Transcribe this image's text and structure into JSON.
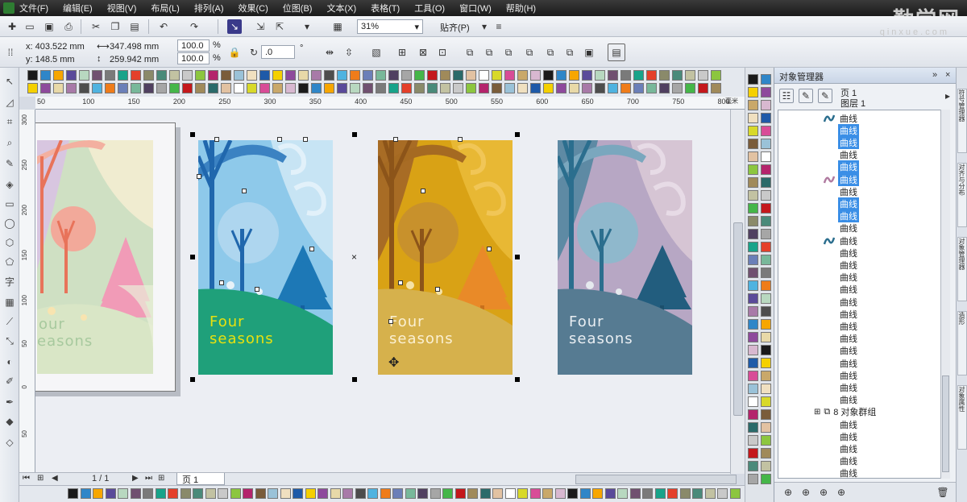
{
  "menu": [
    "文件(F)",
    "编辑(E)",
    "视图(V)",
    "布局(L)",
    "排列(A)",
    "效果(C)",
    "位图(B)",
    "文本(X)",
    "表格(T)",
    "工具(O)",
    "窗口(W)",
    "帮助(H)"
  ],
  "watermark": {
    "main": "勤学网",
    "sub": "qinxue.com"
  },
  "toolbar": {
    "zoom": "31%",
    "snap_label": "贴齐(P)"
  },
  "property_bar": {
    "x": "x: 403.522 mm",
    "y": "y: 148.5 mm",
    "width": "347.498 mm",
    "height": "259.942 mm",
    "scale_w": "100.0",
    "scale_h": "100.0",
    "percent": "%",
    "rotation": ".0",
    "degree": "°"
  },
  "ruler": {
    "h_labels": [
      "50",
      "100",
      "150",
      "200",
      "250",
      "300",
      "350",
      "400",
      "450",
      "500",
      "550",
      "600",
      "650",
      "700",
      "750",
      "800"
    ],
    "v_labels": [
      "300",
      "250",
      "200",
      "150",
      "100",
      "50",
      "0",
      "50"
    ],
    "unit": "毫米"
  },
  "pagenav": {
    "count": "1 / 1",
    "page_tab": "页 1"
  },
  "artwork": {
    "line1": "Four",
    "line2": "seasons",
    "line2_partial": "easons",
    "line1_partial": "our"
  },
  "docker": {
    "title": "对象管理器",
    "page": "页 1",
    "layer": "图层 1",
    "group_label": "8 对象群组",
    "items": [
      "曲线",
      "曲线",
      "曲线",
      "曲线",
      "曲线",
      "曲线",
      "曲线",
      "曲线",
      "曲线",
      "曲线",
      "曲线",
      "曲线",
      "曲线",
      "曲线",
      "曲线",
      "曲线",
      "曲线",
      "曲线",
      "曲线",
      "曲线",
      "曲线",
      "曲线",
      "曲线",
      "曲线"
    ],
    "selected_indices": [
      1,
      2,
      4,
      5,
      7,
      8
    ],
    "items_after_group": [
      "曲线",
      "曲线",
      "曲线",
      "曲线",
      "曲线",
      "曲线"
    ]
  },
  "side_tabs": [
    "符号管理器",
    "对齐与分布",
    "对象管理器",
    "造形",
    "对象属性"
  ],
  "colors": {
    "winter_bg": "#cfe0c3",
    "spring_sky": "#8ec9ea",
    "spring_ground": "#1fa07a",
    "summer_sky": "#d9a215",
    "summer_ground": "#d6b14c",
    "autumn_sky": "#b7a7c4",
    "autumn_ground": "#567b92"
  }
}
